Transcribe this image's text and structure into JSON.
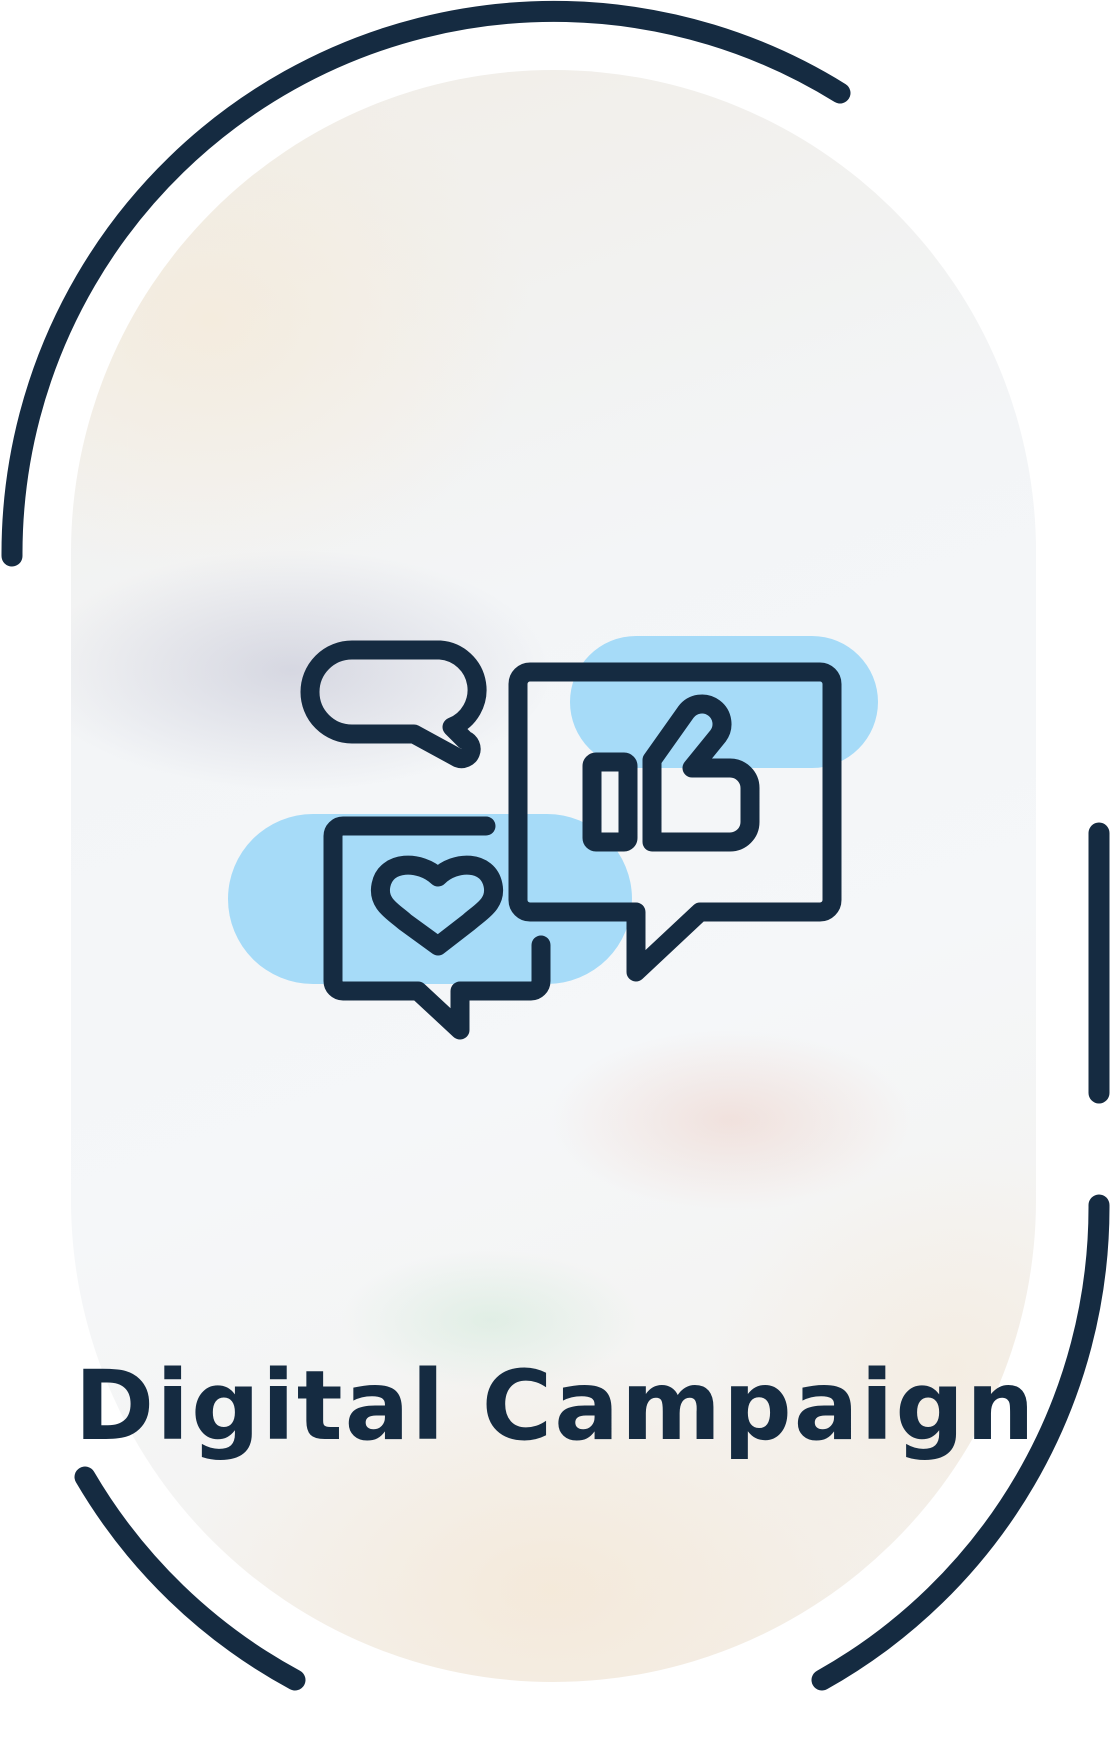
{
  "caption": "Digital Campaign",
  "colors": {
    "outline": "#152b41",
    "accent_blue": "#a6dbf8",
    "background": "#ffffff"
  },
  "icons": [
    "speech-bubble-icon",
    "heart-bubble-icon",
    "thumbs-up-bubble-icon"
  ]
}
